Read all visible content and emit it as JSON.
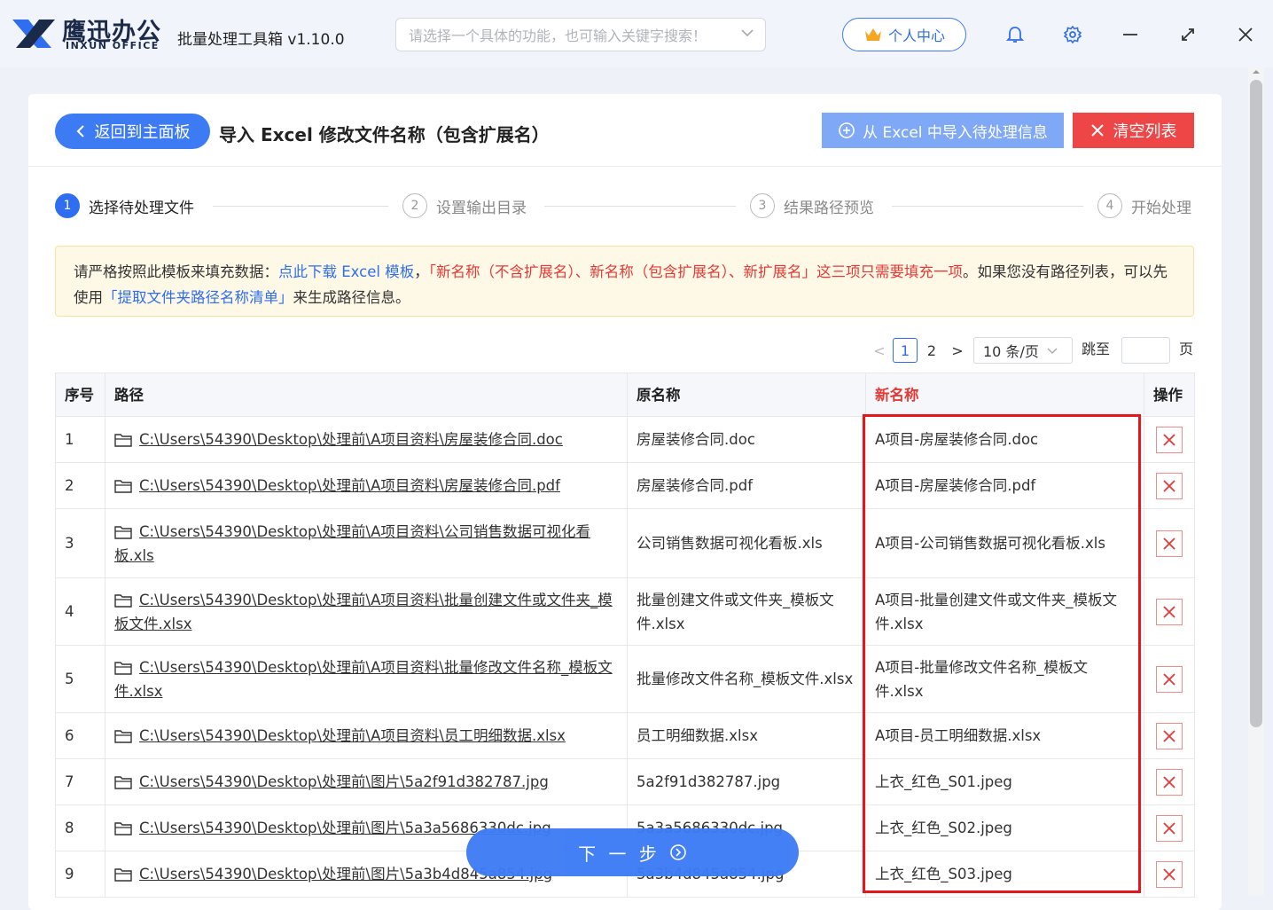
{
  "app": {
    "brand_cn": "鹰迅办公",
    "brand_en": "INXUN OFFICE",
    "title": "批量处理工具箱 v1.10.0"
  },
  "search": {
    "placeholder": "请选择一个具体的功能，也可输入关键字搜索！"
  },
  "header": {
    "user_center": "个人中心"
  },
  "toolbar": {
    "back_label": "返回到主面板",
    "page_title": "导入 Excel 修改文件名称（包含扩展名）",
    "import_label": "从 Excel 中导入待处理信息",
    "clear_label": "清空列表"
  },
  "steps": [
    {
      "num": "1",
      "label": "选择待处理文件"
    },
    {
      "num": "2",
      "label": "设置输出目录"
    },
    {
      "num": "3",
      "label": "结果路径预览"
    },
    {
      "num": "4",
      "label": "开始处理"
    }
  ],
  "notice": {
    "t1": "请严格按照此模板来填充数据：",
    "link1": "点此下载 Excel 模板",
    "t2": "，",
    "red": "「新名称（不含扩展名）、新名称（包含扩展名）、新扩展名」这三项只需要填充一项",
    "t3": "。如果您没有路径列表，可以先使用",
    "link2": "「提取文件夹路径名称清单」",
    "t4": "来生成路径信息。"
  },
  "pagination": {
    "prev": "<",
    "pages": [
      "1",
      "2"
    ],
    "next": ">",
    "page_size": "10 条/页",
    "goto_label": "跳至",
    "page_suffix": "页"
  },
  "table": {
    "headers": {
      "index": "序号",
      "path": "路径",
      "original": "原名称",
      "new_name": "新名称",
      "action": "操作"
    },
    "rows": [
      {
        "index": "1",
        "path": "C:\\Users\\54390\\Desktop\\处理前\\A项目资料\\房屋装修合同.doc",
        "original": "房屋装修合同.doc",
        "new_name": "A项目-房屋装修合同.doc"
      },
      {
        "index": "2",
        "path": "C:\\Users\\54390\\Desktop\\处理前\\A项目资料\\房屋装修合同.pdf",
        "original": "房屋装修合同.pdf",
        "new_name": "A项目-房屋装修合同.pdf"
      },
      {
        "index": "3",
        "path": "C:\\Users\\54390\\Desktop\\处理前\\A项目资料\\公司销售数据可视化看板.xls",
        "original": "公司销售数据可视化看板.xls",
        "new_name": "A项目-公司销售数据可视化看板.xls"
      },
      {
        "index": "4",
        "path": "C:\\Users\\54390\\Desktop\\处理前\\A项目资料\\批量创建文件或文件夹_模板文件.xlsx",
        "original": "批量创建文件或文件夹_模板文件.xlsx",
        "new_name": "A项目-批量创建文件或文件夹_模板文件.xlsx"
      },
      {
        "index": "5",
        "path": "C:\\Users\\54390\\Desktop\\处理前\\A项目资料\\批量修改文件名称_模板文件.xlsx",
        "original": "批量修改文件名称_模板文件.xlsx",
        "new_name": "A项目-批量修改文件名称_模板文件.xlsx"
      },
      {
        "index": "6",
        "path": "C:\\Users\\54390\\Desktop\\处理前\\A项目资料\\员工明细数据.xlsx",
        "original": "员工明细数据.xlsx",
        "new_name": "A项目-员工明细数据.xlsx"
      },
      {
        "index": "7",
        "path": "C:\\Users\\54390\\Desktop\\处理前\\图片\\5a2f91d382787.jpg",
        "original": "5a2f91d382787.jpg",
        "new_name": "上衣_红色_S01.jpeg"
      },
      {
        "index": "8",
        "path": "C:\\Users\\54390\\Desktop\\处理前\\图片\\5a3a5686330dc.jpg",
        "original": "5a3a5686330dc.jpg",
        "new_name": "上衣_红色_S02.jpeg"
      },
      {
        "index": "9",
        "path": "C:\\Users\\54390\\Desktop\\处理前\\图片\\5a3b4d845a854.jpg",
        "original": "5a3b4d845a854.jpg",
        "new_name": "上衣_红色_S03.jpeg"
      }
    ]
  },
  "footer": {
    "next_label": "下 一 步"
  },
  "colors": {
    "primary": "#3d7bf5",
    "danger": "#ee4646",
    "highlight_border": "#e8161b",
    "notice_bg": "#fef9e7"
  },
  "icons": {
    "back": "chevron-left-icon",
    "import": "plus-circle-icon",
    "clear": "close-icon",
    "bell": "bell-icon",
    "gear": "gear-icon",
    "minimize": "minimize-icon",
    "maximize": "maximize-icon",
    "close": "close-icon",
    "folder": "folder-icon",
    "delete": "delete-x-icon"
  }
}
